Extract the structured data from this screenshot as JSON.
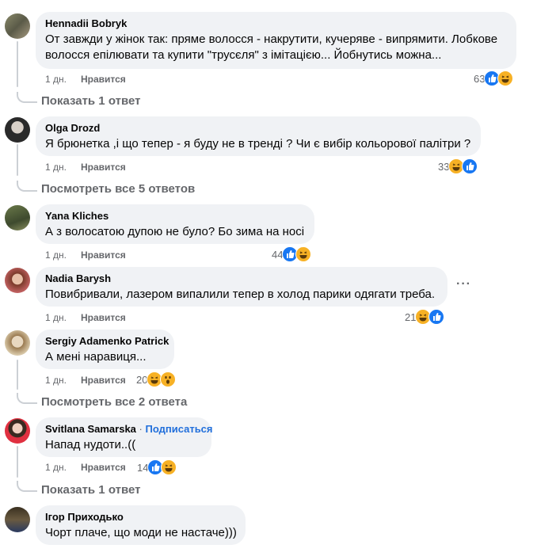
{
  "comments": [
    {
      "author": "Hennadii Bobryk",
      "text_lines": [
        "От завжди у жінок так: пряме волосся - накрутити, кучеряве - випрямити. Лобкове",
        "волосся епілювати та купити \"трусєля\" з імітацією... Йобнутись можна..."
      ],
      "time": "1 дн.",
      "like_label": "Нравится",
      "reaction_count": "63",
      "reactions": [
        "like-icon",
        "haha-icon"
      ],
      "replies": "Показать 1 ответ"
    },
    {
      "author": "Olga Drozd",
      "text": "Я брюнетка ,і що тепер - я буду не в тренді ? Чи є вибір кольорової палітри ?",
      "time": "1 дн.",
      "like_label": "Нравится",
      "reaction_count": "33",
      "reactions": [
        "haha-icon",
        "like-icon"
      ],
      "replies": "Посмотреть все 5 ответов"
    },
    {
      "author": "Yana Kliches",
      "text": "А з волосатою дупою не було? Бо зима на носі",
      "time": "1 дн.",
      "like_label": "Нравится",
      "reaction_count": "44",
      "reactions": [
        "like-icon",
        "haha-icon"
      ]
    },
    {
      "author": "Nadia Barysh",
      "text": "Повибривали, лазером випалили тепер в холод парики одягати треба.",
      "time": "1 дн.",
      "like_label": "Нравится",
      "reaction_count": "21",
      "reactions": [
        "haha-icon",
        "like-icon"
      ],
      "more": "···"
    },
    {
      "author": "Sergiy Adamenko Patrick",
      "text": "А мені наравиця...",
      "time": "1 дн.",
      "like_label": "Нравится",
      "reaction_count": "20",
      "reactions": [
        "haha-icon",
        "wow-icon"
      ],
      "replies": "Посмотреть все 2 ответа"
    },
    {
      "author": "Svitlana Samarska",
      "separator": "·",
      "follow": "Подписаться",
      "text": "Напад нудоти..((",
      "time": "1 дн.",
      "like_label": "Нравится",
      "reaction_count": "14",
      "reactions": [
        "like-icon",
        "haha-icon"
      ],
      "replies": "Показать 1 ответ"
    },
    {
      "author": "Ігор Приходько",
      "text": "Чорт плаче, що моди не настаче)))"
    }
  ],
  "colors": {
    "bubble": "#f0f2f5",
    "like": "#1877f2",
    "haha": "#f7b125",
    "link": "#216fdb",
    "meta": "#65676b"
  }
}
